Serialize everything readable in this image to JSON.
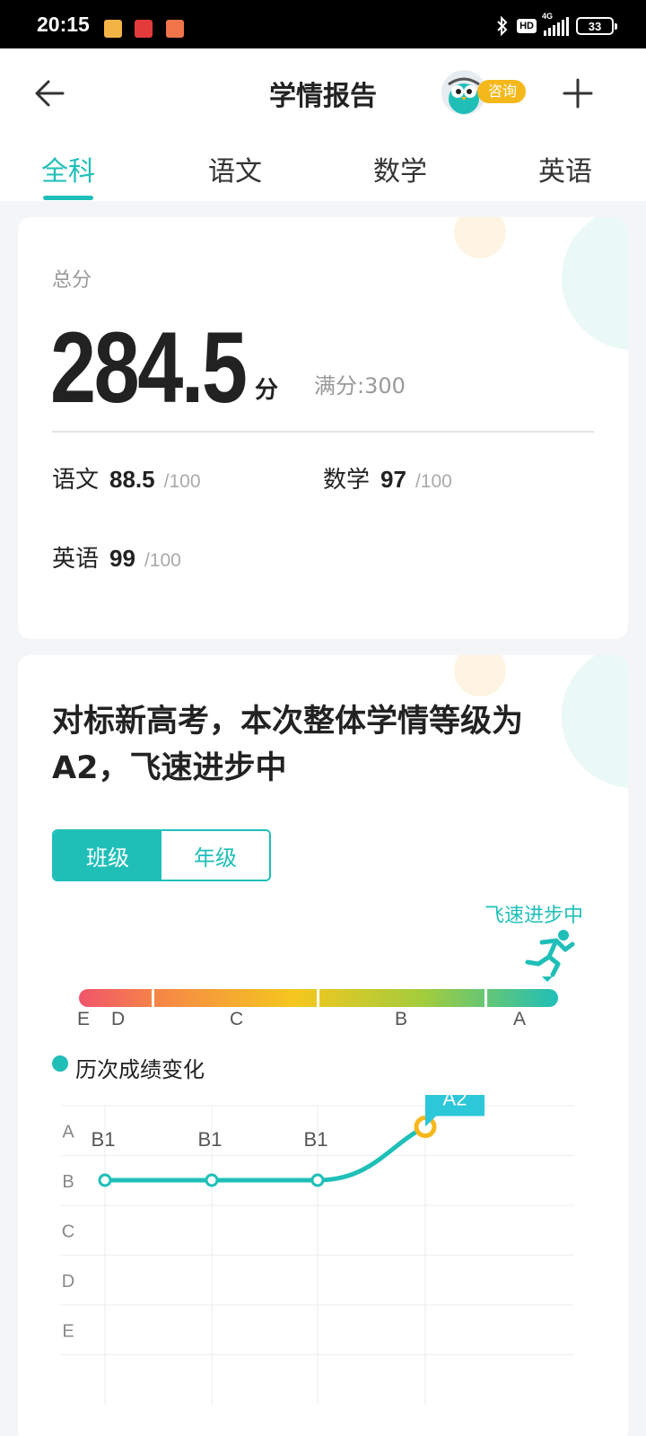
{
  "status": {
    "time": "20:15",
    "battery": "33",
    "network": "4G",
    "hd": "HD"
  },
  "header": {
    "title": "学情报告",
    "consult": "咨询"
  },
  "tabs": [
    {
      "label": "全科"
    },
    {
      "label": "语文"
    },
    {
      "label": "数学"
    },
    {
      "label": "英语"
    }
  ],
  "summary": {
    "label": "总分",
    "score": "284.5",
    "unit": "分",
    "full": "满分:300",
    "subjects": [
      {
        "name": "语文",
        "score": "88.5",
        "max": "/100"
      },
      {
        "name": "数学",
        "score": "97",
        "max": "/100"
      },
      {
        "name": "英语",
        "score": "99",
        "max": "/100"
      }
    ]
  },
  "level": {
    "headline": "对标新高考，本次整体学情等级为A2，飞速进步中",
    "toggle": {
      "class_label": "班级",
      "grade_label": "年级"
    },
    "progress_label": "飞速进步中",
    "grades": [
      "E",
      "D",
      "C",
      "B",
      "A"
    ],
    "current_grade": "A",
    "history_label": "历次成绩变化"
  },
  "chart_data": {
    "type": "line",
    "y_categories": [
      "A",
      "B",
      "C",
      "D",
      "E"
    ],
    "points": [
      {
        "label": "B1",
        "level": 1
      },
      {
        "label": "B1",
        "level": 1
      },
      {
        "label": "B1",
        "level": 1
      },
      {
        "label": "A2",
        "level": 0
      }
    ],
    "grid": true,
    "colors": {
      "line": "#1fbfb8",
      "highlight": "#f5b81b",
      "callout": "#2cc7d9"
    }
  }
}
